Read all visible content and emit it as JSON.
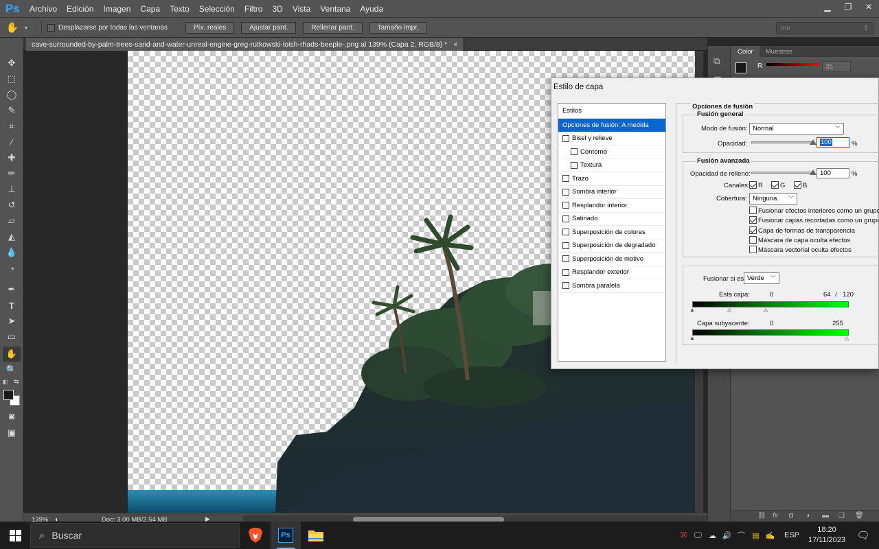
{
  "app": {
    "logo": "Ps"
  },
  "menu": [
    "Archivo",
    "Edición",
    "Imagen",
    "Capa",
    "Texto",
    "Selección",
    "Filtro",
    "3D",
    "Vista",
    "Ventana",
    "Ayuda"
  ],
  "options_bar": {
    "scroll_all": "Desplazarse por todas las ventanas",
    "buttons": [
      "Píx. reales",
      "Ajustar pant.",
      "Rellenar pant.",
      "Tamaño impr."
    ],
    "workspace": "ms"
  },
  "document": {
    "tab_title": "cave-surrounded-by-palm-trees-sand-and-water-unreal-engine-greg-rutkowski-loish-rhads-beeple-.png al 139% (Capa 2, RGB/8) *",
    "close": "×"
  },
  "status": {
    "zoom": "139%",
    "doc_info": "Doc: 3,00 MB/2,54 MB"
  },
  "panels": {
    "tabs": [
      "Color",
      "Muestras"
    ],
    "color_r_label": "R",
    "color_r_value": "35"
  },
  "dialog": {
    "title": "Estilo de capa",
    "styles_header": "Estilos",
    "styles": [
      {
        "label": "Opciones de fusión: A medida",
        "has_checkbox": false,
        "selected": true
      },
      {
        "label": "Bisel y relieve",
        "has_checkbox": true,
        "checked": false
      },
      {
        "label": "Contorno",
        "has_checkbox": true,
        "checked": false,
        "indent": true
      },
      {
        "label": "Textura",
        "has_checkbox": true,
        "checked": false,
        "indent": true
      },
      {
        "label": "Trazo",
        "has_checkbox": true,
        "checked": false
      },
      {
        "label": "Sombra interior",
        "has_checkbox": true,
        "checked": false
      },
      {
        "label": "Resplandor interior",
        "has_checkbox": true,
        "checked": false
      },
      {
        "label": "Satinado",
        "has_checkbox": true,
        "checked": false
      },
      {
        "label": "Superposición de colores",
        "has_checkbox": true,
        "checked": false
      },
      {
        "label": "Superposición de degradado",
        "has_checkbox": true,
        "checked": false
      },
      {
        "label": "Superposición de motivo",
        "has_checkbox": true,
        "checked": false
      },
      {
        "label": "Resplandor exterior",
        "has_checkbox": true,
        "checked": false
      },
      {
        "label": "Sombra paralela",
        "has_checkbox": true,
        "checked": false
      }
    ],
    "blend_options": {
      "title": "Opciones de fusión",
      "general": {
        "title": "Fusión general",
        "mode_label": "Modo de fusión:",
        "mode_value": "Normal",
        "opacity_label": "Opacidad:",
        "opacity_value": "100",
        "opacity_level": 100,
        "percent": "%"
      },
      "advanced": {
        "title": "Fusión avanzada",
        "fill_label": "Opacidad de relleno:",
        "fill_value": "100",
        "fill_level": 100,
        "percent": "%",
        "channels_label": "Canales:",
        "channels": [
          {
            "label": "R",
            "checked": true
          },
          {
            "label": "G",
            "checked": true
          },
          {
            "label": "B",
            "checked": true
          }
        ],
        "knockout_label": "Cobertura:",
        "knockout_value": "Ninguna",
        "options": [
          {
            "label": "Fusionar efectos interiores como un grupo",
            "checked": false
          },
          {
            "label": "Fusionar capas recortadas como un grupo",
            "checked": true
          },
          {
            "label": "Capa de formas de transparencia",
            "checked": true
          },
          {
            "label": "Máscara de capa oculta efectos",
            "checked": false
          },
          {
            "label": "Máscara vectorial oculta efectos",
            "checked": false
          }
        ]
      },
      "blend_if": {
        "label": "Fusionar si es:",
        "value": "Verde",
        "this_layer_label": "Esta capa:",
        "this_layer_low": "0",
        "this_layer_high_a": "64",
        "separator": "/",
        "this_layer_high_b": "120",
        "underlying_label": "Capa subyacente:",
        "underlying_low": "0",
        "underlying_high": "255"
      }
    }
  },
  "taskbar": {
    "search_placeholder": "Buscar",
    "lang": "ESP",
    "time": "18:20",
    "date": "17/11/2023"
  }
}
